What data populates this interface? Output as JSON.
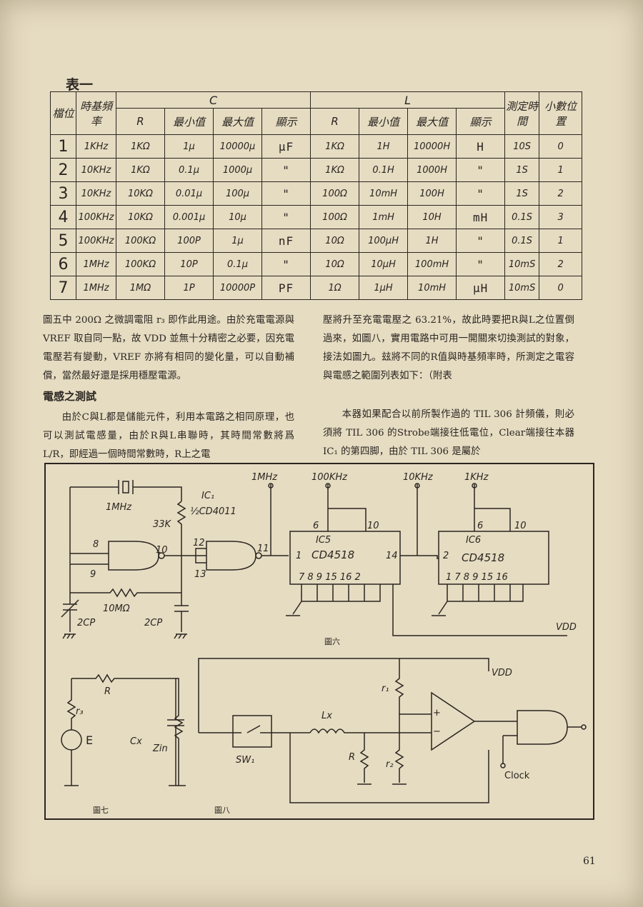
{
  "table": {
    "title": "表一",
    "headers": {
      "position": "檔位",
      "timebase": "時基頻率",
      "c_group": "C",
      "l_group": "L",
      "r": "R",
      "min": "最小值",
      "max": "最大值",
      "display": "顯示",
      "measure_time": "測定時間",
      "decimal": "小數位置"
    },
    "rows": [
      {
        "pos": "1",
        "freq": "1KHz",
        "c_r": "1KΩ",
        "c_min": "1μ",
        "c_max": "10000μ",
        "c_disp": "μF",
        "l_r": "1KΩ",
        "l_min": "1H",
        "l_max": "10000H",
        "l_disp": "H",
        "time": "10S",
        "dec": "0"
      },
      {
        "pos": "2",
        "freq": "10KHz",
        "c_r": "1KΩ",
        "c_min": "0.1μ",
        "c_max": "1000μ",
        "c_disp": "\"",
        "l_r": "1KΩ",
        "l_min": "0.1H",
        "l_max": "1000H",
        "l_disp": "\"",
        "time": "1S",
        "dec": "1"
      },
      {
        "pos": "3",
        "freq": "10KHz",
        "c_r": "10KΩ",
        "c_min": "0.01μ",
        "c_max": "100μ",
        "c_disp": "\"",
        "l_r": "100Ω",
        "l_min": "10mH",
        "l_max": "100H",
        "l_disp": "\"",
        "time": "1S",
        "dec": "2"
      },
      {
        "pos": "4",
        "freq": "100KHz",
        "c_r": "10KΩ",
        "c_min": "0.001μ",
        "c_max": "10μ",
        "c_disp": "\"",
        "l_r": "100Ω",
        "l_min": "1mH",
        "l_max": "10H",
        "l_disp": "mH",
        "time": "0.1S",
        "dec": "3"
      },
      {
        "pos": "5",
        "freq": "100KHz",
        "c_r": "100KΩ",
        "c_min": "100P",
        "c_max": "1μ",
        "c_disp": "nF",
        "l_r": "10Ω",
        "l_min": "100μH",
        "l_max": "1H",
        "l_disp": "\"",
        "time": "0.1S",
        "dec": "1"
      },
      {
        "pos": "6",
        "freq": "1MHz",
        "c_r": "100KΩ",
        "c_min": "10P",
        "c_max": "0.1μ",
        "c_disp": "\"",
        "l_r": "10Ω",
        "l_min": "10μH",
        "l_max": "100mH",
        "l_disp": "\"",
        "time": "10mS",
        "dec": "2"
      },
      {
        "pos": "7",
        "freq": "1MHz",
        "c_r": "1MΩ",
        "c_min": "1P",
        "c_max": "10000P",
        "c_disp": "PF",
        "l_r": "1Ω",
        "l_min": "1μH",
        "l_max": "10mH",
        "l_disp": "μH",
        "time": "10mS",
        "dec": "0"
      }
    ]
  },
  "body": {
    "left_p1": "圖五中 200Ω 之微調電阻 r₃ 即作此用途。由於充電電源與 VREF 取自同一點，故 VDD 並無十分精密之必要，因充電電壓若有變動，VREF 亦將有相同的變化量，可以自動補償，當然最好還是採用穩壓電源。",
    "heading": "電感之測試",
    "left_p2": "由於C與L都是儲能元件，利用本電路之相同原理，也可以測試電感量，由於R與L串聯時，其時間常數將爲 L/R，即經過一個時間常數時，R上之電",
    "right_p1": "壓將升至充電電壓之 63.21%，故此時要把R與L之位置倒過來，如圖八，實用電路中可用一開關來切換測試的對象，接法如圖九。玆將不同的R值與時基頻率時，所測定之電容與電感之範圍列表如下：（附表",
    "right_p2": "本器如果配合以前所製作過的 TIL 306 計頻儀，則必須將 TIL 306 的Strobe端接往低電位，Clear端接往本器 IC₁ 的第四脚，由於 TIL 306 是屬於"
  },
  "fig6": {
    "caption": "圖六",
    "lbl_1mhz_top": "1MHz",
    "lbl_100khz": "100KHz",
    "lbl_10khz": "10KHz",
    "lbl_1khz": "1KHz",
    "lbl_crystal": "1MHz",
    "lbl_ic1": "IC₁",
    "lbl_ic1_part": "½CD4011",
    "lbl_33k": "33K",
    "lbl_pin8": "8",
    "lbl_pin9": "9",
    "lbl_pin10": "10",
    "lbl_pin12": "12",
    "lbl_pin13": "13",
    "lbl_pin11": "11",
    "lbl_10m": "10MΩ",
    "lbl_2cp_a": "2CP",
    "lbl_2cp_b": "2CP",
    "lbl_ic5": "IC5",
    "lbl_ic5_part": "CD4518",
    "lbl_ic5_in": "1",
    "lbl_ic5_out": "14",
    "lbl_ic5_p6": "6",
    "lbl_ic5_p10": "10",
    "lbl_ic5_bottom": "7 8 9 15 16 2",
    "lbl_ic6": "IC6",
    "lbl_ic6_part": "CD4518",
    "lbl_ic6_in": "2",
    "lbl_ic6_p6": "6",
    "lbl_ic6_p10": "10",
    "lbl_ic6_bottom": "1 7 8 9 15 16",
    "lbl_vdd": "VDD"
  },
  "fig7": {
    "caption": "圖七",
    "lbl_r": "R",
    "lbl_r3": "r₃",
    "lbl_e": "E",
    "lbl_cx": "Cx",
    "lbl_zin": "Zin"
  },
  "fig8": {
    "caption": "圖八",
    "lbl_vdd": "VDD",
    "lbl_r1": "r₁",
    "lbl_r2": "r₂",
    "lbl_r": "R",
    "lbl_lx": "Lx",
    "lbl_sw": "SW₁",
    "lbl_plus": "+",
    "lbl_minus": "−",
    "lbl_clock": "Clock"
  },
  "page_number": "61"
}
